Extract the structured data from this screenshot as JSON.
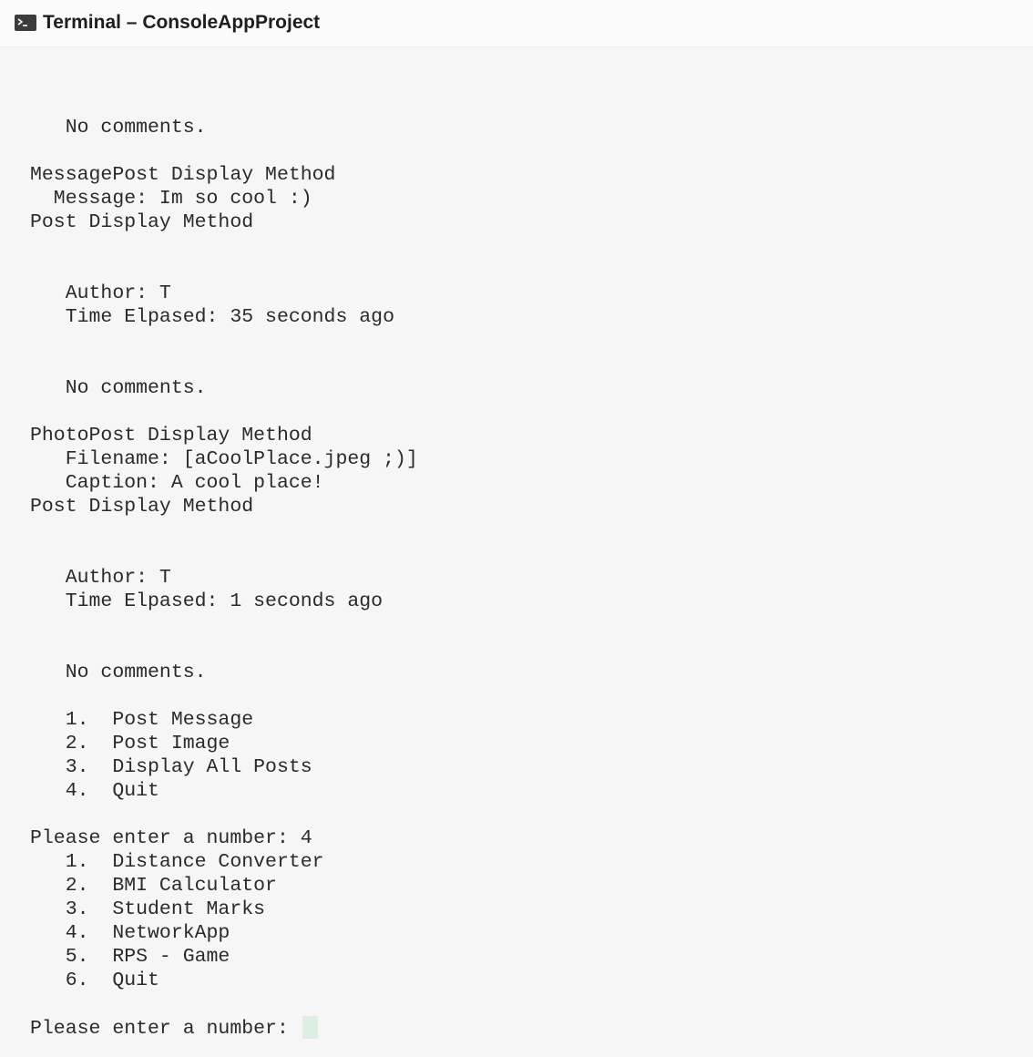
{
  "window": {
    "title": "Terminal – ConsoleAppProject"
  },
  "console": {
    "lines": [
      "   No comments.",
      "",
      "MessagePost Display Method",
      "  Message: Im so cool :)",
      "Post Display Method",
      "",
      "",
      "   Author: T",
      "   Time Elpased: 35 seconds ago",
      "",
      "",
      "   No comments.",
      "",
      "PhotoPost Display Method",
      "   Filename: [aCoolPlace.jpeg ;)]",
      "   Caption: A cool place!",
      "Post Display Method",
      "",
      "",
      "   Author: T",
      "   Time Elpased: 1 seconds ago",
      "",
      "",
      "   No comments.",
      "",
      "   1.  Post Message",
      "   2.  Post Image",
      "   3.  Display All Posts",
      "   4.  Quit",
      "",
      "Please enter a number: 4",
      "   1.  Distance Converter",
      "   2.  BMI Calculator",
      "   3.  Student Marks",
      "   4.  NetworkApp",
      "   5.  RPS - Game",
      "   6.  Quit",
      ""
    ],
    "prompt": "Please enter a number: "
  }
}
